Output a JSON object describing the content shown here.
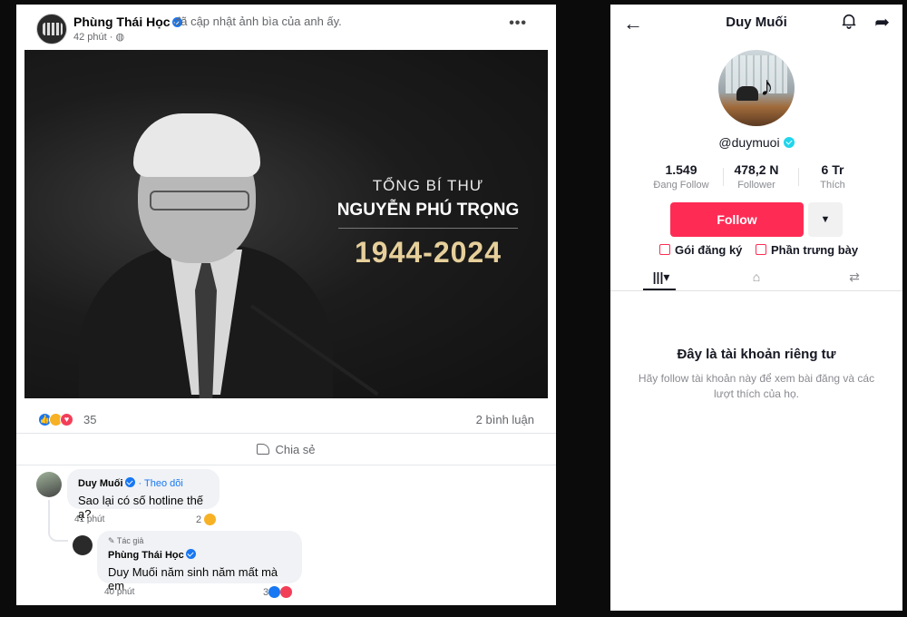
{
  "facebook": {
    "author": "Phùng Thái Học",
    "action": "đã cập nhật ảnh bìa của anh ấy.",
    "time": "42 phút",
    "more": "•••",
    "cover": {
      "line1": "TỔNG BÍ THƯ",
      "line2": "NGUYỄN PHÚ TRỌNG",
      "years": "1944-2024"
    },
    "reaction_count": "35",
    "comment_count": "2 bình luận",
    "share_label": "Chia sẻ",
    "comments": [
      {
        "name": "Duy Muối",
        "follow": "· Theo dõi",
        "text": "Sao lại có số hotline thế ạ?",
        "time": "41 phút",
        "reactions": "2"
      },
      {
        "badge": "✎ Tác giả",
        "name": "Phùng Thái Học",
        "text": "Duy Muối năm sinh năm mất mà em",
        "time": "40 phút",
        "reactions": "3"
      }
    ]
  },
  "tiktok": {
    "title": "Duy Muối",
    "handle": "@duymuoi",
    "stats": [
      {
        "value": "1.549",
        "label": "Đang Follow"
      },
      {
        "value": "478,2 N",
        "label": "Follower"
      },
      {
        "value": "6 Tr",
        "label": "Thích"
      }
    ],
    "follow_label": "Follow",
    "dropdown": "▼",
    "links": [
      "Gói đăng ký",
      "Phần trưng bày"
    ],
    "tabs": [
      "|||▾",
      "⌂",
      "⇄"
    ],
    "private_title": "Đây là tài khoản riêng tư",
    "private_desc": "Hãy follow tài khoản này để xem bài đăng và các lượt thích của họ.",
    "colors": {
      "follow": "#fe2c55",
      "verified": "#20d5ec"
    }
  },
  "colors": {
    "fb_blue": "#1877f2",
    "cover_gold": "#e6cf9a"
  }
}
